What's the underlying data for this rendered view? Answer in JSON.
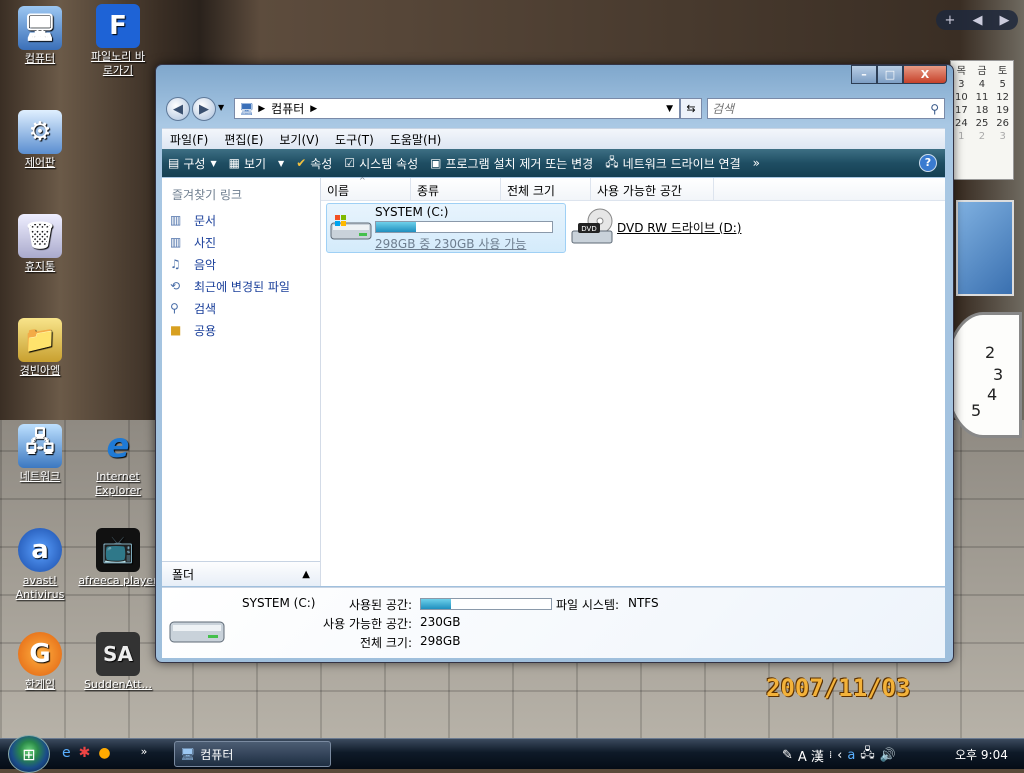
{
  "desktop": {
    "date_stamp": "2007/11/03",
    "icons": [
      {
        "label": "컴퓨터"
      },
      {
        "label": "파일노리 바로가기"
      },
      {
        "label": "제어판"
      },
      {
        "label": "휴지통"
      },
      {
        "label": "경빈아엠"
      },
      {
        "label": "네트워크"
      },
      {
        "label": "Internet Explorer"
      },
      {
        "label": "avast! Antivirus"
      },
      {
        "label": "afreeca player"
      },
      {
        "label": "한게임"
      },
      {
        "label": "SuddenAtt..."
      }
    ]
  },
  "gadgets": {
    "calendar": {
      "headers": [
        "목",
        "금",
        "토"
      ],
      "rows": [
        [
          "",
          "",
          "5"
        ],
        [
          "3",
          "4",
          "5"
        ],
        [
          "10",
          "11",
          "12"
        ],
        [
          "17",
          "18",
          "19"
        ],
        [
          "24",
          "25",
          "26"
        ],
        [
          "1",
          "2",
          "3"
        ]
      ]
    },
    "clock": {
      "numbers": [
        "2",
        "3",
        "4",
        "5"
      ]
    }
  },
  "window": {
    "buttons": {
      "minimize": "–",
      "maximize": "□",
      "close": "X"
    },
    "address": {
      "icon": "computer-icon",
      "path": "컴퓨터"
    },
    "search": {
      "placeholder": "검색"
    },
    "menu": [
      "파일(F)",
      "편집(E)",
      "보기(V)",
      "도구(T)",
      "도움말(H)"
    ],
    "commands": [
      {
        "label": "구성",
        "dropdown": true
      },
      {
        "label": "보기",
        "dropdown": true
      },
      {
        "label": "속성"
      },
      {
        "label": "시스템 속성"
      },
      {
        "label": "프로그램 설치 제거 또는 변경"
      },
      {
        "label": "네트워크 드라이브 연결"
      }
    ],
    "more": "»",
    "help": "?",
    "nav": {
      "title": "즐겨찾기 링크",
      "items": [
        "문서",
        "사진",
        "음악",
        "최근에 변경된 파일",
        "검색",
        "공용"
      ],
      "folder_label": "폴더"
    },
    "columns": [
      "이름",
      "종류",
      "전체 크기",
      "사용 가능한 공간"
    ],
    "drives": [
      {
        "name": "SYSTEM (C:)",
        "usage_fraction": 0.23,
        "sub": "298GB 중 230GB 사용 가능"
      },
      {
        "name": "DVD RW 드라이브 (D:)"
      }
    ],
    "details": {
      "name": "SYSTEM (C:)",
      "used_label": "사용된 공간:",
      "used_fraction": 0.23,
      "fs_label": "파일 시스템:",
      "fs_value": "NTFS",
      "free_label": "사용 가능한 공간:",
      "free_value": "230GB",
      "total_label": "전체 크기:",
      "total_value": "298GB"
    }
  },
  "taskbar": {
    "task_label": "컴퓨터",
    "tray_ime": "A 漢",
    "clock": "오후 9:04"
  },
  "colors": {
    "accent": "#1f4e63",
    "link": "#1a3f9a",
    "usage": "#1f8fbf"
  }
}
